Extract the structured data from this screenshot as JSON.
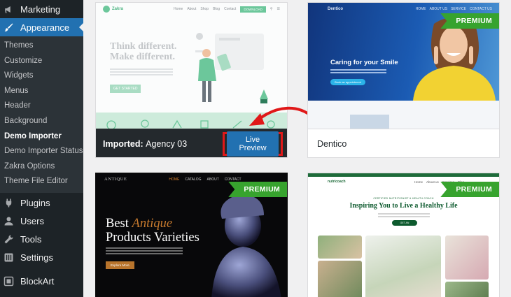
{
  "sidebar": {
    "top_item": {
      "label": "Marketing",
      "icon": "megaphone-icon"
    },
    "active_item": {
      "label": "Appearance",
      "icon": "paintbrush-icon"
    },
    "submenu": [
      "Themes",
      "Customize",
      "Widgets",
      "Menus",
      "Header",
      "Background",
      "Demo Importer",
      "Demo Importer Status",
      "Zakra Options",
      "Theme File Editor"
    ],
    "current_submenu": "Demo Importer",
    "bottom_items": [
      {
        "label": "Plugins",
        "icon": "plug-icon"
      },
      {
        "label": "Users",
        "icon": "user-icon"
      },
      {
        "label": "Tools",
        "icon": "wrench-icon"
      },
      {
        "label": "Settings",
        "icon": "settings-icon"
      },
      {
        "label": "BlockArt",
        "icon": "blockart-icon"
      }
    ]
  },
  "cards": {
    "zakra": {
      "logo": "Zakra",
      "nav": [
        "Home",
        "About",
        "Shop",
        "Blog",
        "Contact"
      ],
      "nav_button": "DOWNLOAD",
      "headline_1": "Think different.",
      "headline_2": "Make different.",
      "cta": "GET STARTED",
      "imported_label": "Imported:",
      "imported_name": "Agency 03",
      "live_preview": "Live Preview"
    },
    "dentico": {
      "name": "Dentico",
      "badge": "PREMIUM",
      "logo": "Dentico",
      "nav": [
        "HOME",
        "ABOUT US",
        "SERVICE",
        "CONTACT US"
      ],
      "hero_title": "Caring for your Smile",
      "hero_button": "Book an appointment"
    },
    "antique": {
      "badge": "PREMIUM",
      "logo": "ANTIQUE",
      "nav": [
        "HOME",
        "CATALOG",
        "ABOUT",
        "CONTACT"
      ],
      "headline_1": "Best",
      "headline_accent": "Antique",
      "headline_2": "Products Varieties",
      "cta": "Explore More"
    },
    "health": {
      "badge": "PREMIUM",
      "logo": "nutricoach",
      "nav": [
        "Home",
        "About us",
        "Services",
        "Blog"
      ],
      "kicker": "CERTIFIED NUTRITIONIST & HEALTH COACH",
      "headline": "Inspiring You to Live a Healthy Life",
      "cta": "GET AN APPOINTMENT"
    }
  },
  "colors": {
    "sidebar_bg": "#1d2327",
    "active_bg": "#2271b1",
    "premium_green": "#37a32e",
    "highlight_red": "#e01818"
  }
}
